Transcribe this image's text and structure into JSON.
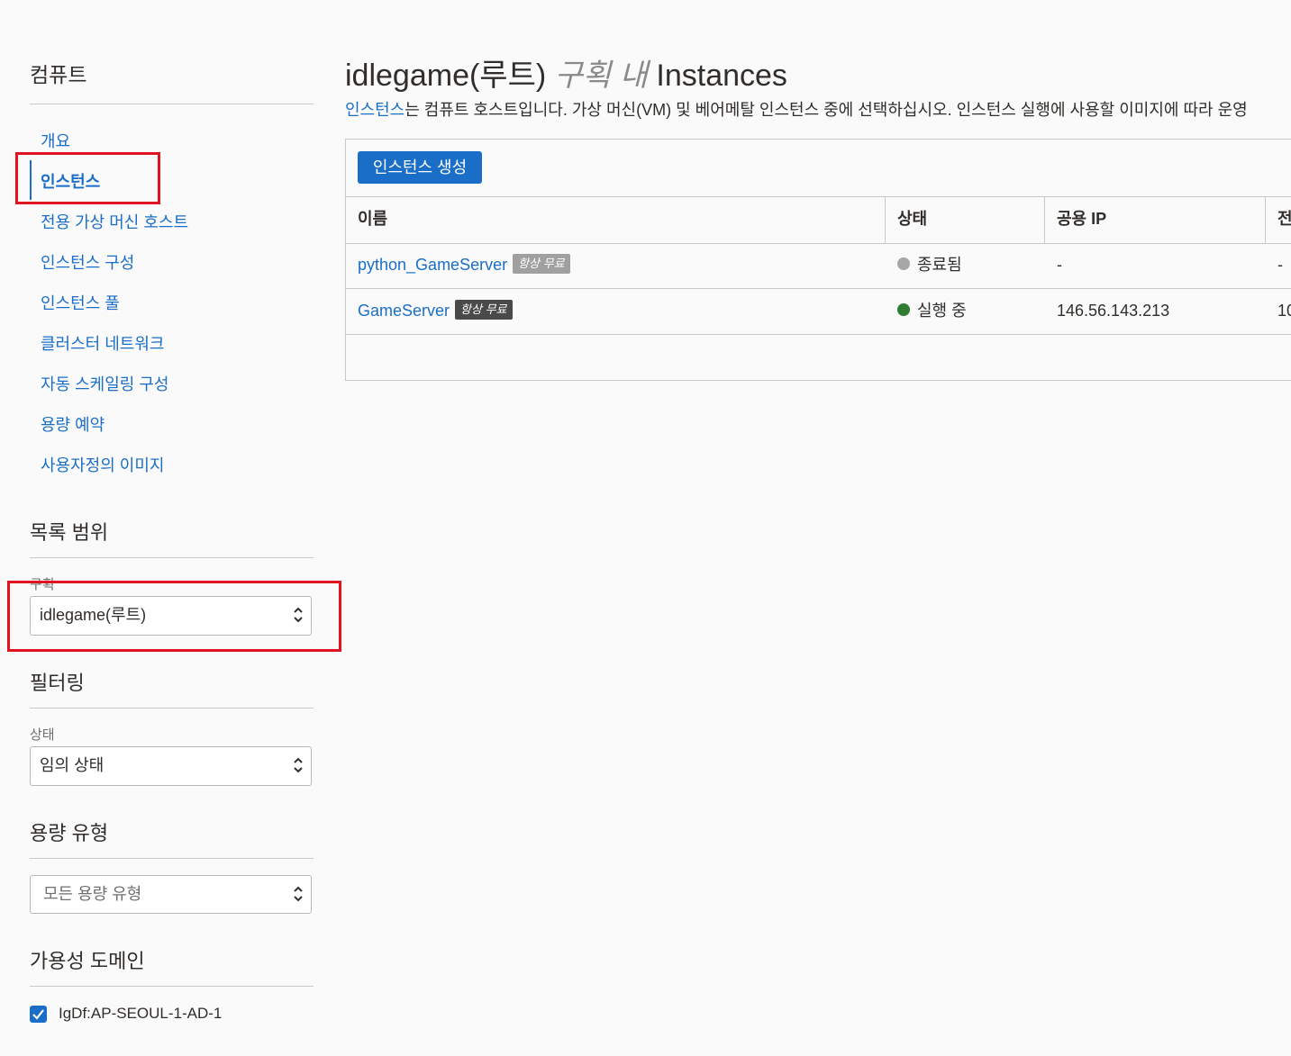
{
  "sidebar": {
    "section_title": "컴퓨트",
    "nav": [
      {
        "label": "개요"
      },
      {
        "label": "인스턴스"
      },
      {
        "label": "전용 가상 머신 호스트"
      },
      {
        "label": "인스턴스 구성"
      },
      {
        "label": "인스턴스 풀"
      },
      {
        "label": "클러스터 네트워크"
      },
      {
        "label": "자동 스케일링 구성"
      },
      {
        "label": "용량 예약"
      },
      {
        "label": "사용자정의 이미지"
      }
    ],
    "active_nav": "인스턴스",
    "scope": {
      "title": "목록 범위",
      "compartment_label": "구획",
      "compartment_value": "idlegame(루트)"
    },
    "filter": {
      "title": "필터링",
      "state_label": "상태",
      "state_value": "임의 상태"
    },
    "capacity": {
      "title": "용량 유형",
      "value": "모든 용량 유형"
    },
    "availability": {
      "title": "가용성 도메인",
      "checkbox_label": "IgDf:AP-SEOUL-1-AD-1",
      "checked": true
    }
  },
  "main": {
    "title_compartment": "idlegame(루트)",
    "title_in": "구획 내",
    "title_resource": "Instances",
    "desc_link": "인스턴스",
    "desc_text": "는 컴퓨트 호스트입니다. 가상 머신(VM) 및 베어메탈 인스턴스 중에 선택하십시오. 인스턴스 실행에 사용할 이미지에 따라 운영",
    "create_button": "인스턴스 생성",
    "table": {
      "headers": [
        "이름",
        "상태",
        "공용 IP",
        "전"
      ],
      "rows": [
        {
          "name": "python_GameServer",
          "badge": "항상 무료",
          "status": "종료됨",
          "status_color": "#a7a7a7",
          "public_ip": "-",
          "extra": "-",
          "badge_color": "#a0a0a0"
        },
        {
          "name": "GameServer",
          "badge": "항상 무료",
          "status": "실행 중",
          "status_color": "#2e7d32",
          "public_ip": "146.56.143.213",
          "extra": "10",
          "badge_color": "#4a4a4a"
        }
      ]
    }
  },
  "colors": {
    "accent": "#1a6ec7",
    "highlight": "#e0141e"
  }
}
